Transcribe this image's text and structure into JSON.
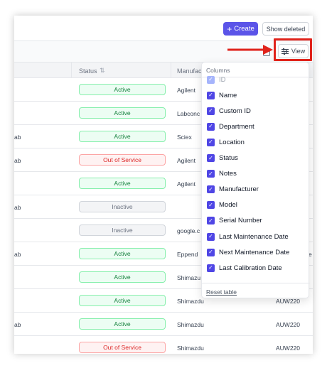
{
  "toolbar": {
    "create_label": "Create",
    "show_deleted_label": "Show deleted",
    "view_label": "View"
  },
  "table": {
    "headers": {
      "status": "Status",
      "manufacturer": "Manufac"
    },
    "rows": [
      {
        "name": "",
        "status": "Active",
        "status_kind": "active",
        "manufacturer": "Agilent",
        "model": "",
        "extra": ""
      },
      {
        "name": "",
        "status": "Active",
        "status_kind": "active",
        "manufacturer": "Labconc",
        "model": "",
        "extra": ""
      },
      {
        "name": "ab",
        "status": "Active",
        "status_kind": "active",
        "manufacturer": "Sciex",
        "model": "",
        "extra": ""
      },
      {
        "name": "ab",
        "status": "Out of Service",
        "status_kind": "oos",
        "manufacturer": "Agilent",
        "model": "",
        "extra": ""
      },
      {
        "name": "",
        "status": "Active",
        "status_kind": "active",
        "manufacturer": "Agilent",
        "model": "",
        "extra": ""
      },
      {
        "name": "ab",
        "status": "Inactive",
        "status_kind": "inactive",
        "manufacturer": "",
        "model": "",
        "extra": ""
      },
      {
        "name": "",
        "status": "Inactive",
        "status_kind": "inactive",
        "manufacturer": "google.c",
        "model": "",
        "extra": ""
      },
      {
        "name": "ab",
        "status": "Active",
        "status_kind": "active",
        "manufacturer": "Eppend",
        "model": "",
        "extra": "e"
      },
      {
        "name": "",
        "status": "Active",
        "status_kind": "active",
        "manufacturer": "Shimazu",
        "model": "",
        "extra": ""
      },
      {
        "name": "",
        "status": "Active",
        "status_kind": "active",
        "manufacturer": "Shimazdu",
        "model": "AUW220",
        "extra": ""
      },
      {
        "name": "ab",
        "status": "Active",
        "status_kind": "active",
        "manufacturer": "Shimazdu",
        "model": "AUW220",
        "extra": ""
      },
      {
        "name": "",
        "status": "Out of Service",
        "status_kind": "oos",
        "manufacturer": "Shimazdu",
        "model": "AUW220",
        "extra": ""
      }
    ]
  },
  "columns_menu": {
    "title": "Columns",
    "items": [
      {
        "label": "ID",
        "checked": true,
        "disabled": true
      },
      {
        "label": "Name",
        "checked": true,
        "disabled": false
      },
      {
        "label": "Custom ID",
        "checked": true,
        "disabled": false
      },
      {
        "label": "Department",
        "checked": true,
        "disabled": false
      },
      {
        "label": "Location",
        "checked": true,
        "disabled": false
      },
      {
        "label": "Status",
        "checked": true,
        "disabled": false
      },
      {
        "label": "Notes",
        "checked": true,
        "disabled": false
      },
      {
        "label": "Manufacturer",
        "checked": true,
        "disabled": false
      },
      {
        "label": "Model",
        "checked": true,
        "disabled": false
      },
      {
        "label": "Serial Number",
        "checked": true,
        "disabled": false
      },
      {
        "label": "Last Maintenance Date",
        "checked": true,
        "disabled": false
      },
      {
        "label": "Next Maintenance Date",
        "checked": true,
        "disabled": false
      },
      {
        "label": "Last Calibration Date",
        "checked": true,
        "disabled": false
      }
    ],
    "reset_label": "Reset table"
  },
  "colors": {
    "accent": "#5b54e8",
    "checkbox": "#4f46e5",
    "highlight": "#e0231b",
    "active": "#15803d",
    "out_of_service": "#dc2626",
    "inactive": "#6b7280"
  }
}
